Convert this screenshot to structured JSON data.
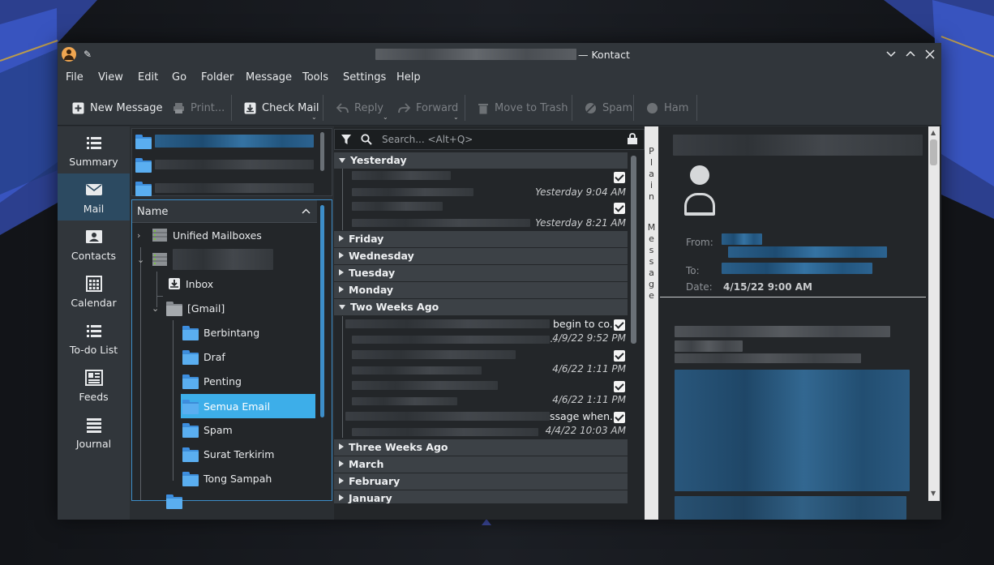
{
  "window": {
    "title_suffix": "— Kontact",
    "controls": [
      "minimize",
      "maximize",
      "close"
    ]
  },
  "menu": [
    "File",
    "View",
    "Edit",
    "Go",
    "Folder",
    "Message",
    "Tools",
    "Settings",
    "Help"
  ],
  "toolbar": {
    "new_message": "New Message",
    "print": "Print...",
    "check_mail": "Check Mail",
    "reply": "Reply",
    "forward": "Forward",
    "move_to_trash": "Move to Trash",
    "spam": "Spam",
    "ham": "Ham"
  },
  "sidebar": {
    "items": [
      {
        "label": "Summary",
        "icon": "list-icon"
      },
      {
        "label": "Mail",
        "icon": "mail-icon"
      },
      {
        "label": "Contacts",
        "icon": "contact-card-icon"
      },
      {
        "label": "Calendar",
        "icon": "calendar-icon"
      },
      {
        "label": "To-do List",
        "icon": "todo-list-icon"
      },
      {
        "label": "Feeds",
        "icon": "feeds-icon"
      },
      {
        "label": "Journal",
        "icon": "journal-icon"
      }
    ],
    "active": "Mail"
  },
  "folder_tree": {
    "header": "Name",
    "folders": {
      "unified": "Unified Mailboxes",
      "inbox": "Inbox",
      "gmail": "[Gmail]",
      "starred": "Berbintang",
      "drafts": "Draf",
      "important": "Penting",
      "all_mail": "Semua Email",
      "spam": "Spam",
      "sent": "Surat Terkirim",
      "trash": "Tong Sampah"
    },
    "selected": "Semua Email"
  },
  "message_list": {
    "search_placeholder": "Search... <Alt+Q>",
    "groups": {
      "yesterday": "Yesterday",
      "friday": "Friday",
      "wednesday": "Wednesday",
      "tuesday": "Tuesday",
      "monday": "Monday",
      "two_weeks": "Two Weeks Ago",
      "three_weeks": "Three Weeks Ago",
      "march": "March",
      "february": "February",
      "january": "January"
    },
    "messages": [
      {
        "subject_tail": "",
        "date": "Yesterday 9:04 AM"
      },
      {
        "subject_tail": "",
        "date": "Yesterday 8:21 AM"
      },
      {
        "subject_tail": "begin to co...",
        "date": "4/9/22 9:52 PM",
        "prefix": ".."
      },
      {
        "subject_tail": "",
        "date": "4/6/22 1:11 PM"
      },
      {
        "subject_tail": "",
        "date": "4/6/22 1:11 PM"
      },
      {
        "subject_tail": "ssage when...",
        "date": "4/4/22 10:03 AM"
      }
    ]
  },
  "view_mode": {
    "plain": "Plain",
    "message": "Message"
  },
  "reader": {
    "from_label": "From:",
    "to_label": "To:",
    "date_label": "Date:",
    "date_value": "4/15/22 9:00 AM"
  },
  "colors": {
    "accent": "#3daee9",
    "window_bg": "#2a2e32",
    "view_bg": "#232629"
  }
}
